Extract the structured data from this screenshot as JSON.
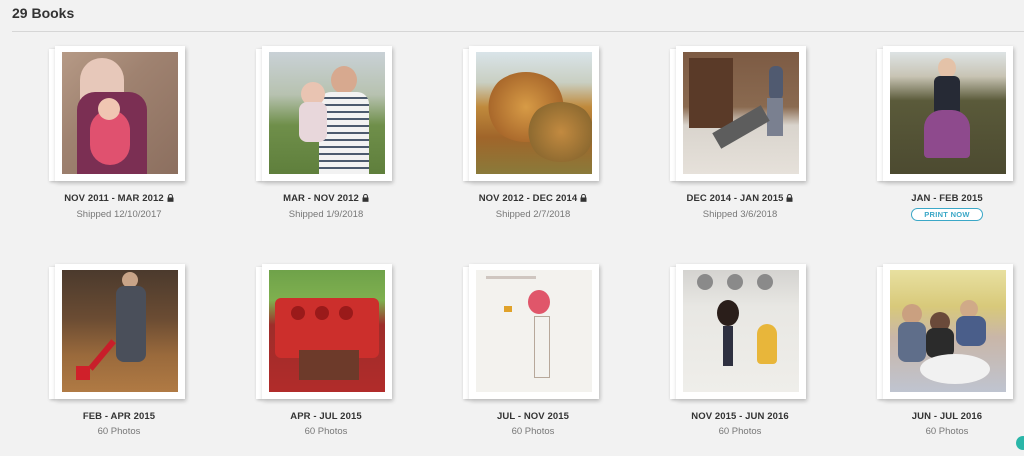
{
  "header": {
    "title": "29 Books"
  },
  "books": [
    {
      "title": "NOV 2011 - MAR 2012",
      "locked": true,
      "sub": "Shipped 12/10/2017"
    },
    {
      "title": "MAR - NOV 2012",
      "locked": true,
      "sub": "Shipped 1/9/2018"
    },
    {
      "title": "NOV 2012 - DEC 2014",
      "locked": true,
      "sub": "Shipped 2/7/2018"
    },
    {
      "title": "DEC 2014 - JAN 2015",
      "locked": true,
      "sub": "Shipped 3/6/2018"
    },
    {
      "title": "JAN - FEB 2015",
      "locked": false,
      "button": "PRINT NOW"
    },
    {
      "title": "FEB - APR 2015",
      "locked": false,
      "sub": "60 Photos"
    },
    {
      "title": "APR - JUL 2015",
      "locked": false,
      "sub": "60 Photos"
    },
    {
      "title": "JUL - NOV 2015",
      "locked": false,
      "sub": "60 Photos"
    },
    {
      "title": "NOV 2015 - JUN 2016",
      "locked": false,
      "sub": "60 Photos"
    },
    {
      "title": "JUN - JUL 2016",
      "locked": false,
      "sub": "60 Photos"
    }
  ],
  "colors": {
    "accent": "#3aa7c7",
    "background": "#f2f2f2"
  },
  "icons": {
    "lock": "lock-icon"
  }
}
